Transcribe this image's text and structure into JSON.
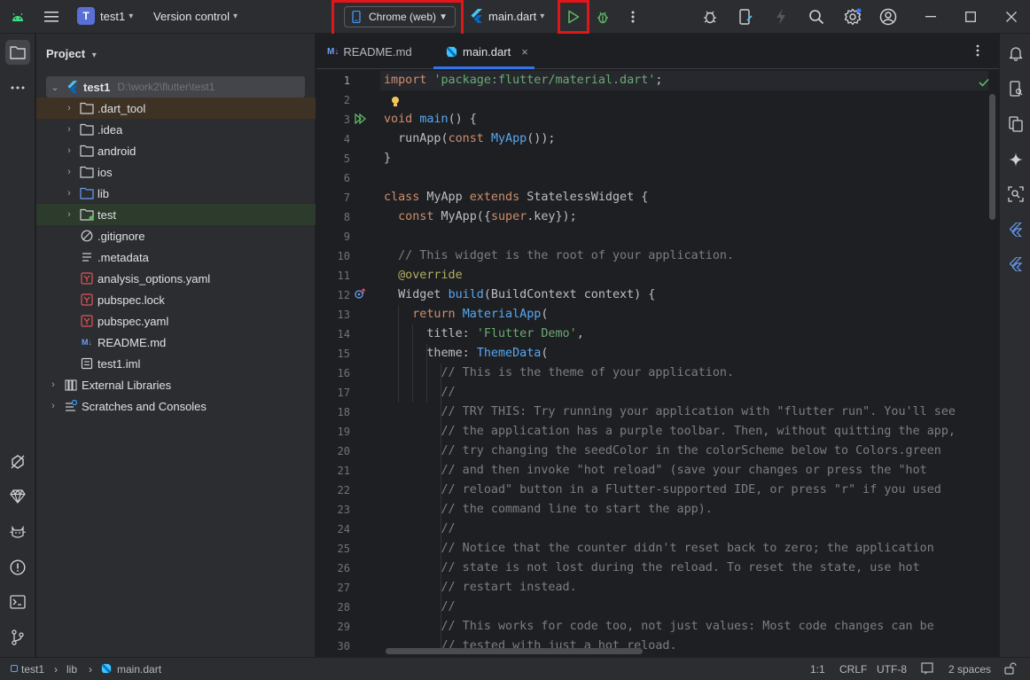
{
  "titlebar": {
    "project_badge": "T",
    "project_name": "test1",
    "vcs_label": "Version control",
    "device_label": "Chrome (web)",
    "run_config": "main.dart"
  },
  "project_panel": {
    "title": "Project",
    "root": {
      "name": "test1",
      "path": "D:\\work2\\flutter\\test1"
    },
    "items": [
      {
        "name": ".dart_tool",
        "type": "folder",
        "expandable": true
      },
      {
        "name": ".idea",
        "type": "folder",
        "expandable": true
      },
      {
        "name": "android",
        "type": "folder",
        "expandable": true
      },
      {
        "name": "ios",
        "type": "folder",
        "expandable": true
      },
      {
        "name": "lib",
        "type": "folder-blue",
        "expandable": true
      },
      {
        "name": "test",
        "type": "folder-test",
        "expandable": true
      },
      {
        "name": ".gitignore",
        "type": "ignore",
        "expandable": false
      },
      {
        "name": ".metadata",
        "type": "text",
        "expandable": false
      },
      {
        "name": "analysis_options.yaml",
        "type": "yaml",
        "expandable": false
      },
      {
        "name": "pubspec.lock",
        "type": "yaml",
        "expandable": false
      },
      {
        "name": "pubspec.yaml",
        "type": "yaml",
        "expandable": false
      },
      {
        "name": "README.md",
        "type": "md",
        "expandable": false
      },
      {
        "name": "test1.iml",
        "type": "iml",
        "expandable": false
      }
    ],
    "external_libraries": "External Libraries",
    "scratches": "Scratches and Consoles"
  },
  "tabs": [
    {
      "label": "README.md",
      "icon": "markdown-icon",
      "active": false
    },
    {
      "label": "main.dart",
      "icon": "dart-icon",
      "active": true
    }
  ],
  "code_lines": [
    "import 'package:flutter/material.dart';",
    "",
    "void main() {",
    "  runApp(const MyApp());",
    "}",
    "",
    "class MyApp extends StatelessWidget {",
    "  const MyApp({super.key});",
    "",
    "  // This widget is the root of your application.",
    "  @override",
    "  Widget build(BuildContext context) {",
    "    return MaterialApp(",
    "      title: 'Flutter Demo',",
    "      theme: ThemeData(",
    "        // This is the theme of your application.",
    "        //",
    "        // TRY THIS: Try running your application with \"flutter run\". You'll see",
    "        // the application has a purple toolbar. Then, without quitting the app,",
    "        // try changing the seedColor in the colorScheme below to Colors.green",
    "        // and then invoke \"hot reload\" (save your changes or press the \"hot",
    "        // reload\" button in a Flutter-supported IDE, or press \"r\" if you used",
    "        // the command line to start the app).",
    "        //",
    "        // Notice that the counter didn't reset back to zero; the application",
    "        // state is not lost during the reload. To reset the state, use hot",
    "        // restart instead.",
    "        //",
    "        // This works for code too, not just values: Most code changes can be",
    "        // tested with just a hot reload."
  ],
  "line_numbers": [
    "1",
    "2",
    "3",
    "4",
    "5",
    "6",
    "7",
    "8",
    "9",
    "10",
    "11",
    "12",
    "13",
    "14",
    "15",
    "16",
    "17",
    "18",
    "19",
    "20",
    "21",
    "22",
    "23",
    "24",
    "25",
    "26",
    "27",
    "28",
    "29",
    "30"
  ],
  "statusbar": {
    "breadcrumb": [
      "test1",
      "lib",
      "main.dart"
    ],
    "position": "1:1",
    "line_ending": "CRLF",
    "encoding": "UTF-8",
    "indent": "2 spaces"
  },
  "colors": {
    "highlight_box": "#e0161b",
    "accent": "#3574f0",
    "run_green": "#5fb865"
  }
}
